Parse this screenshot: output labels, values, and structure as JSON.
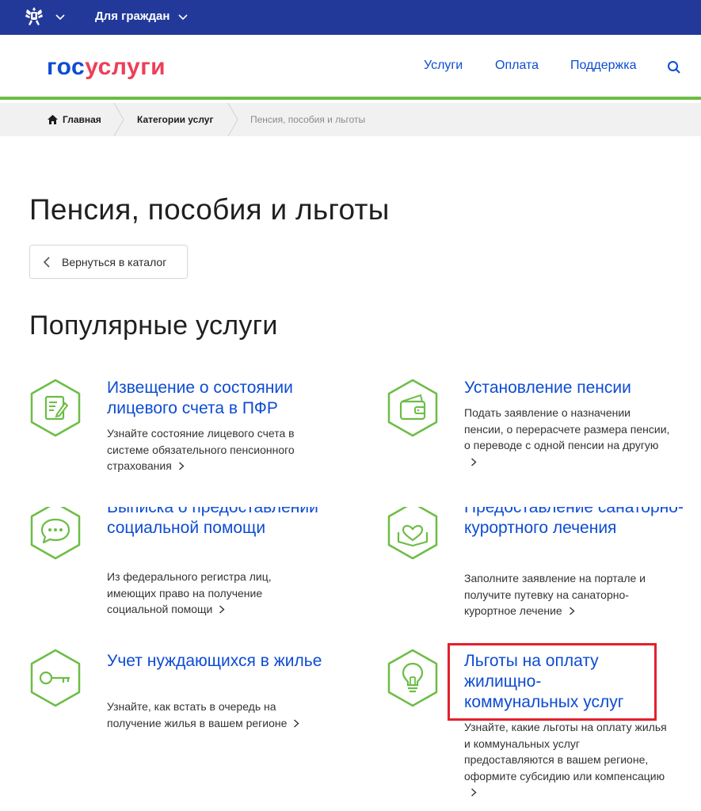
{
  "topbar": {
    "emblem_icon": "russian-emblem-icon",
    "citizens_label": "Для граждан"
  },
  "header": {
    "logo_part1": "гос",
    "logo_part2": "услуги",
    "nav": [
      "Услуги",
      "Оплата",
      "Поддержка"
    ],
    "search_icon": "search-icon"
  },
  "breadcrumb": {
    "home": "Главная",
    "categories": "Категории услуг",
    "current": "Пенсия, пособия и льготы"
  },
  "page": {
    "title": "Пенсия, пособия и льготы",
    "back_label": "Вернуться в каталог",
    "section_title": "Популярные услуги"
  },
  "services": [
    {
      "title": "Извещение о состоянии лицевого счета в ПФР",
      "desc": "Узнайте состояние лицевого счета в системе обязательного пенсионного страхования",
      "icon": "document-edit-icon"
    },
    {
      "title": "Установление пенсии",
      "desc": "Подать заявление о назначении пенсии, о перерасчете размера пенсии, о переводе с одной пенсии на другую",
      "icon": "wallet-icon"
    },
    {
      "title": "Выписка о предоставлении социальной помощи",
      "desc": "Из федерального регистра лиц, имеющих право на получение социальной помощи",
      "icon": "chat-bubble-icon"
    },
    {
      "title": "Предоставление санаторно-курортного лечения",
      "desc": "Заполните заявление на портале и получите путевку на санаторно-курортное лечение",
      "icon": "heart-hands-icon"
    },
    {
      "title": "Учет нуждающихся в жилье",
      "desc": "Узнайте, как встать в очередь на получение жилья в вашем регионе",
      "icon": "key-icon"
    },
    {
      "title": "Льготы на оплату жилищно-коммунальных услуг",
      "desc": "Узнайте, какие льготы на оплату жилья и коммунальных услуг предоставляются в вашем регионе, оформите субсидию или компенсацию",
      "icon": "lightbulb-icon"
    }
  ],
  "colors": {
    "topbar": "#23399a",
    "link": "#0d4cd3",
    "logo_red": "#ee3f58",
    "accent_green": "#6cbd45",
    "highlight": "#e3202d"
  }
}
